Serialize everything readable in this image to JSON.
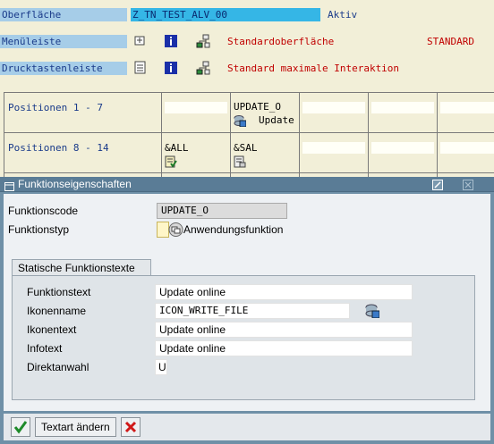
{
  "top": {
    "surface_label": "Oberfläche",
    "surface_value": "Z_TN_TEST_ALV_00",
    "surface_status": "Aktiv",
    "menubar_label": "Menüleiste",
    "menubar_text": "Standardoberfläche",
    "menubar_code": "STANDARD",
    "toolbar_label": "Drucktastenleiste",
    "toolbar_text": "Standard maximale Interaktion"
  },
  "grid": {
    "row1_label": "Positionen  1 -  7",
    "row1_code": "UPDATE_O",
    "row1_text": "Update",
    "row2_label": "Positionen  8 - 14",
    "row2_code1": "&ALL",
    "row2_code2": "&SAL"
  },
  "dialog": {
    "title": "Funktionseigenschaften",
    "code_label": "Funktionscode",
    "code_value": "UPDATE_O",
    "type_label": "Funktionstyp",
    "type_value": "Anwendungsfunktion",
    "tab_label": "Statische Funktionstexte",
    "fields": {
      "text_label": "Funktionstext",
      "text_value": "Update online",
      "iconname_label": "Ikonenname",
      "iconname_value": "ICON_WRITE_FILE",
      "icontext_label": "Ikonentext",
      "icontext_value": "Update online",
      "info_label": "Infotext",
      "info_value": "Update online",
      "direct_label": "Direktanwahl",
      "direct_value": "U"
    },
    "buttons": {
      "change_text": "Textart ändern"
    }
  },
  "colors": {
    "label_blue": "#a6cde8",
    "dialog_bg": "#6f90a7",
    "title_bar": "#5a7c96",
    "error_red": "#c00000"
  }
}
